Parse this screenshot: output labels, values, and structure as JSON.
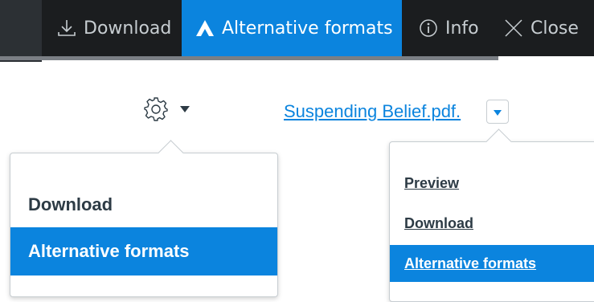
{
  "toolbar": {
    "download_label": "Download",
    "alternative_formats_label": "Alternative formats",
    "info_label": "Info",
    "close_label": "Close",
    "active_color": "#0b84de",
    "background_color": "#1b1d1f"
  },
  "gear_menu": {
    "icon": "gear-icon",
    "items": [
      {
        "label": "Download"
      },
      {
        "label": "Alternative formats",
        "selected": true
      }
    ]
  },
  "file": {
    "name": "Suspending Belief.pdf.",
    "menu_icon": "caret-down-icon",
    "items": [
      {
        "label": "Preview"
      },
      {
        "label": "Download"
      },
      {
        "label": "Alternative formats",
        "selected": true
      }
    ]
  }
}
